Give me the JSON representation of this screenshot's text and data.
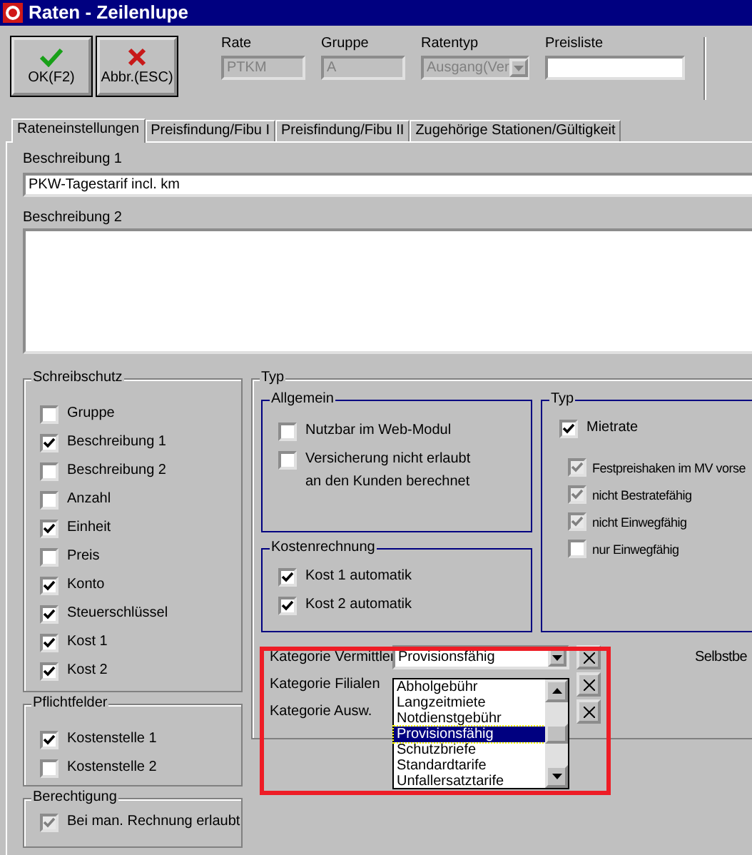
{
  "window": {
    "title": "Raten - Zeilenlupe"
  },
  "toolbar": {
    "buttons": [
      {
        "label": "OK(F2)",
        "kind": "ok"
      },
      {
        "label": "Abbr.(ESC)",
        "kind": "cancel"
      }
    ],
    "fields": [
      {
        "label": "Rate",
        "value": "PTKM",
        "kind": "text",
        "disabled": true
      },
      {
        "label": "Gruppe",
        "value": "A",
        "kind": "text",
        "disabled": true
      },
      {
        "label": "Ratentyp",
        "value": "Ausgang(Ver",
        "kind": "select",
        "disabled": true
      },
      {
        "label": "Preisliste",
        "kind": "text",
        "disabled": false
      }
    ]
  },
  "tabs": [
    {
      "label": "Rateneinstellungen",
      "selected": true
    },
    {
      "label": "Preisfindung/Fibu I",
      "selected": false
    },
    {
      "label": "Preisfindung/Fibu II",
      "selected": false
    },
    {
      "label": "Zugehörige Stationen/Gültigkeit",
      "selected": false
    }
  ],
  "descriptions": [
    {
      "label": "Beschreibung 1",
      "value": "PKW-Tagestarif incl. km",
      "kind": "line"
    },
    {
      "label": "Beschreibung 2",
      "kind": "area"
    }
  ],
  "left_groups": [
    {
      "title": "Schreibschutz",
      "items": [
        {
          "label": "Gruppe",
          "checked": false,
          "disabled": false
        },
        {
          "label": "Beschreibung 1",
          "checked": true,
          "disabled": false
        },
        {
          "label": "Beschreibung 2",
          "checked": false,
          "disabled": false
        },
        {
          "label": "Anzahl",
          "checked": false,
          "disabled": false
        },
        {
          "label": "Einheit",
          "checked": true,
          "disabled": false
        },
        {
          "label": "Preis",
          "checked": false,
          "disabled": false
        },
        {
          "label": "Konto",
          "checked": true,
          "disabled": false
        },
        {
          "label": "Steuerschlüssel",
          "checked": true,
          "disabled": false
        },
        {
          "label": "Kost 1",
          "checked": true,
          "disabled": false
        },
        {
          "label": "Kost 2",
          "checked": true,
          "disabled": false
        }
      ]
    },
    {
      "title": "Pflichtfelder",
      "items": [
        {
          "label": "Kostenstelle 1",
          "checked": true,
          "disabled": false
        },
        {
          "label": "Kostenstelle 2",
          "checked": false,
          "disabled": false
        }
      ]
    },
    {
      "title": "Berechtigung",
      "items": [
        {
          "label": "Bei man. Rechnung erlaubt",
          "checked": true,
          "disabled": true
        }
      ]
    }
  ],
  "typ_group": {
    "title": "Typ",
    "allgemein": {
      "title": "Allgemein",
      "items": [
        {
          "label": "Nutzbar im Web-Modul",
          "checked": false,
          "disabled": false
        },
        {
          "label": "Versicherung nicht erlaubt",
          "note": "an den Kunden berechnet",
          "checked": false,
          "disabled": false
        }
      ]
    },
    "kostenrechnung": {
      "title": "Kostenrechnung",
      "items": [
        {
          "label": "Kost 1 automatik",
          "checked": true,
          "disabled": false
        },
        {
          "label": "Kost 2 automatik",
          "checked": true,
          "disabled": false
        }
      ]
    },
    "typ": {
      "title": "Typ",
      "main": {
        "label": "Mietrate",
        "checked": true,
        "disabled": false
      },
      "items": [
        {
          "label": "Festpreishaken im MV vorse",
          "checked": true,
          "disabled": true
        },
        {
          "label": "nicht Bestratefähig",
          "checked": true,
          "disabled": true
        },
        {
          "label": "nicht Einwegfähig",
          "checked": true,
          "disabled": true
        },
        {
          "label": "nur Einwegfähig",
          "checked": false,
          "disabled": false
        }
      ]
    },
    "categories": [
      {
        "label": "Kategorie Vermittler",
        "value": "Provisionsfähig"
      },
      {
        "label": "Kategorie Filialen"
      },
      {
        "label": "Kategorie Ausw."
      }
    ],
    "side_label": "Selbstbe",
    "dropdown": {
      "options": [
        {
          "label": "Abholgebühr",
          "selected": false
        },
        {
          "label": "Langzeitmiete",
          "selected": false
        },
        {
          "label": "Notdienstgebühr",
          "selected": false
        },
        {
          "label": "Provisionsfähig",
          "selected": true
        },
        {
          "label": "Schutzbriefe",
          "selected": false
        },
        {
          "label": "Standardtarife",
          "selected": false
        },
        {
          "label": "Unfallersatztarife",
          "selected": false
        }
      ]
    }
  }
}
